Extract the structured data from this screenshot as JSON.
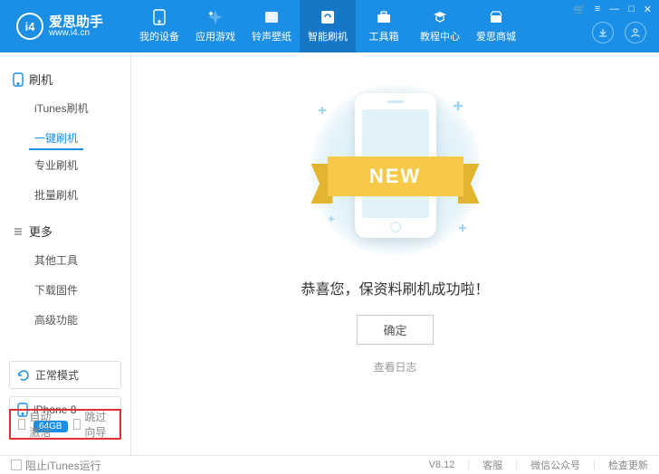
{
  "app": {
    "name": "爱思助手",
    "url": "www.i4.cn",
    "logo_text": "i4"
  },
  "nav": [
    {
      "label": "我的设备"
    },
    {
      "label": "应用游戏"
    },
    {
      "label": "铃声壁纸"
    },
    {
      "label": "智能刷机"
    },
    {
      "label": "工具箱"
    },
    {
      "label": "教程中心"
    },
    {
      "label": "爱思商城"
    }
  ],
  "sidebar": {
    "group1": {
      "title": "刷机",
      "items": [
        "iTunes刷机",
        "一键刷机",
        "专业刷机",
        "批量刷机"
      ]
    },
    "group2": {
      "title": "更多",
      "items": [
        "其他工具",
        "下载固件",
        "高级功能"
      ]
    },
    "mode": "正常模式",
    "device": {
      "name": "iPhone 8",
      "storage": "64GB"
    },
    "opts": {
      "auto_activate": "自动激活",
      "skip_guide": "跳过向导"
    }
  },
  "main": {
    "ribbon": "NEW",
    "success": "恭喜您，保资料刷机成功啦！",
    "ok": "确定",
    "log": "查看日志"
  },
  "footer": {
    "block_itunes": "阻止iTunes运行",
    "version": "V8.12",
    "support": "客服",
    "wechat": "微信公众号",
    "update": "检查更新"
  }
}
